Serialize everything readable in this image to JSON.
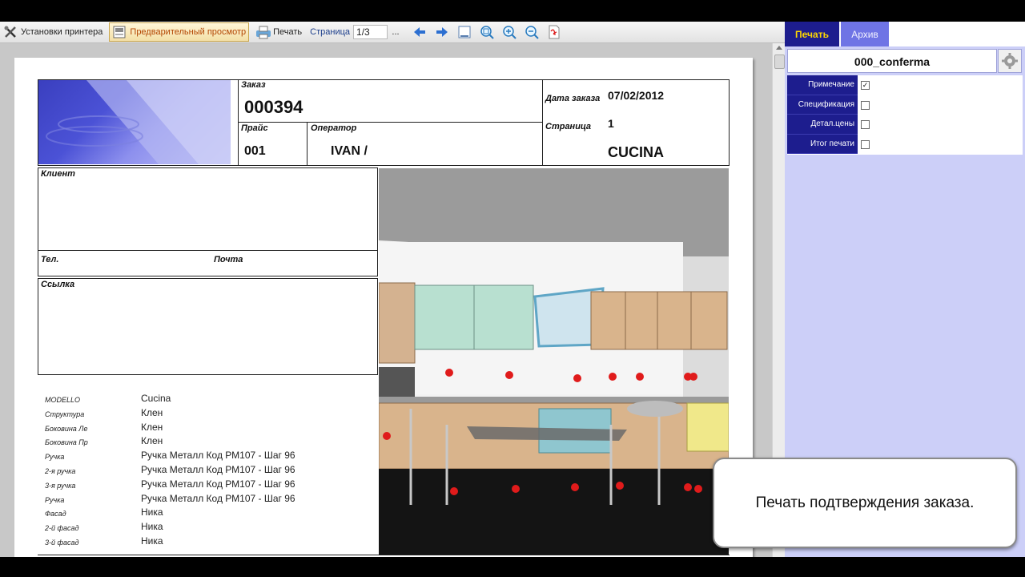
{
  "toolbar": {
    "printer_setup": "Установки принтера",
    "preview": "Предварительный просмотр",
    "print": "Печать",
    "page_label": "Страница",
    "page_value": "1/3",
    "more": "..."
  },
  "report": {
    "order_label": "Заказ",
    "order_number": "000394",
    "price_label": "Прайс",
    "price_value": "001",
    "operator_label": "Оператор",
    "operator_value": "IVAN /",
    "order_date_label": "Дата заказа",
    "order_date_value": "07/02/2012",
    "page_label": "Страница",
    "page_value": "1",
    "room_value": "CUCINA",
    "client_label": "Клиент",
    "phone_label": "Тел.",
    "email_label": "Почта",
    "reference_label": "Ссылка",
    "specs": [
      {
        "key": "MODELLO",
        "value": "Cucina"
      },
      {
        "key": "Структура",
        "value": "Клен"
      },
      {
        "key": "Боковина Ле",
        "value": "Клен"
      },
      {
        "key": "Боковина Пр",
        "value": "Клен"
      },
      {
        "key": "Ручка",
        "value": "Ручка Металл Код РМ107 - Шаг 96"
      },
      {
        "key": "2-я ручка",
        "value": "Ручка Металл Код РМ107 - Шаг 96"
      },
      {
        "key": "3-я ручка",
        "value": "Ручка Металл Код РМ107 - Шаг 96"
      },
      {
        "key": "Ручка",
        "value": "Ручка Металл Код РМ107 - Шаг 96"
      },
      {
        "key": "Фасад",
        "value": "Ника"
      },
      {
        "key": "2-й фасад",
        "value": "Ника"
      },
      {
        "key": "3-й фасад",
        "value": "Ника"
      }
    ]
  },
  "panel": {
    "tabs": [
      {
        "label": "Печать"
      },
      {
        "label": "Архив"
      }
    ],
    "template_name": "000_conferma",
    "options": [
      {
        "label": "Примечание",
        "checked": true
      },
      {
        "label": "Спецификация",
        "checked": false
      },
      {
        "label": "Детал.цены",
        "checked": false
      },
      {
        "label": "Итог печати",
        "checked": false
      }
    ]
  },
  "caption": "Печать подтверждения заказа.",
  "colors": {
    "panel_bg": "#cccff8",
    "panel_dark": "#1d1d8e",
    "tab_active_text": "#ffd700",
    "preview_active_text": "#b34500"
  }
}
